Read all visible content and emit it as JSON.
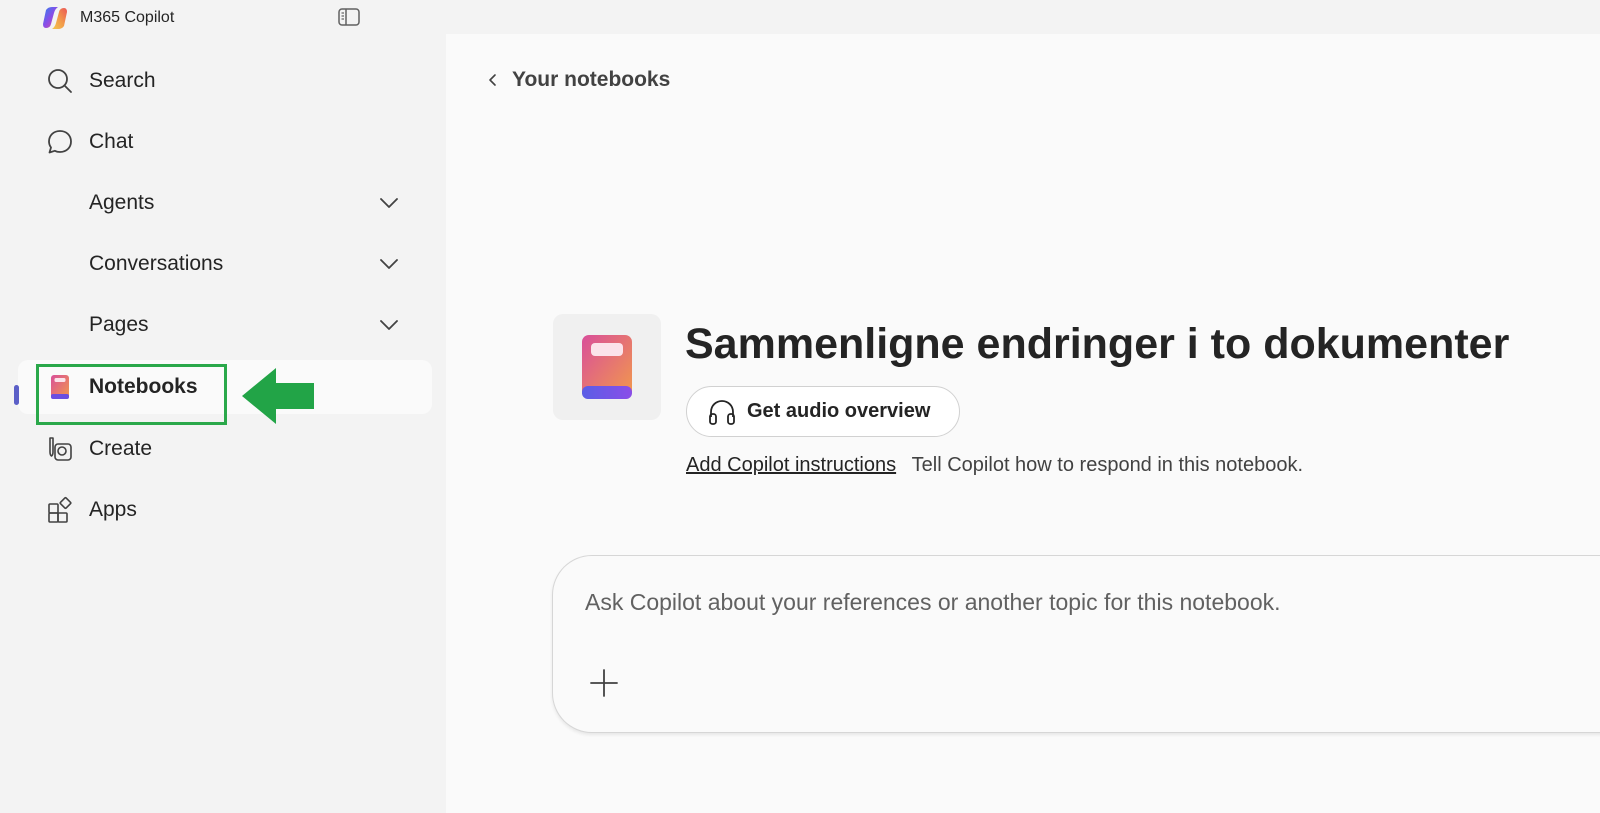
{
  "app": {
    "title": "M365 Copilot"
  },
  "sidebar": {
    "items": [
      {
        "label": "Search",
        "icon": "search-icon"
      },
      {
        "label": "Chat",
        "icon": "chat-icon"
      },
      {
        "label": "Agents",
        "icon": "chevron-down-icon"
      },
      {
        "label": "Conversations",
        "icon": "chevron-down-icon"
      },
      {
        "label": "Pages",
        "icon": "chevron-down-icon"
      },
      {
        "label": "Notebooks",
        "icon": "notebook-icon",
        "active": true
      },
      {
        "label": "Create",
        "icon": "create-icon"
      },
      {
        "label": "Apps",
        "icon": "apps-icon"
      }
    ]
  },
  "main": {
    "back_label": "Your notebooks",
    "notebook_title": "Sammenligne endringer i to dokumenter",
    "audio_button_label": "Get audio overview",
    "add_instructions_label": "Add Copilot instructions",
    "instructions_help": "Tell Copilot how to respond in this notebook.",
    "prompt_placeholder": "Ask Copilot about your references or another topic for this notebook."
  },
  "colors": {
    "accent": "#5b5fc7",
    "highlight": "#2aa84a",
    "sidebar_bg": "#f3f3f3",
    "main_bg": "#fafafa"
  }
}
